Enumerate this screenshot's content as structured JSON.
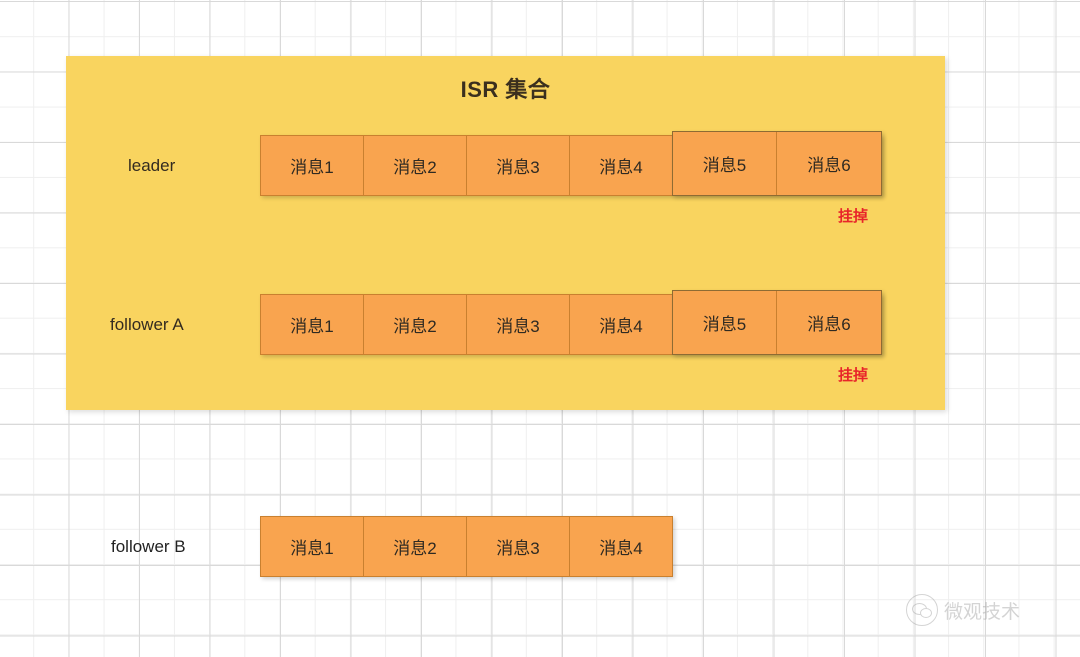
{
  "diagram": {
    "title": "ISR 集合",
    "panel_color": "#f9d45f",
    "message_box_color": "#f9a44f",
    "crash_label_color": "#e8252a",
    "rows": [
      {
        "label": "leader",
        "inside_isr": true,
        "messages": [
          "消息1",
          "消息2",
          "消息3",
          "消息4",
          "消息5",
          "消息6"
        ],
        "grouped_from_index": 4,
        "crash_label": "挂掉"
      },
      {
        "label": "follower A",
        "inside_isr": true,
        "messages": [
          "消息1",
          "消息2",
          "消息3",
          "消息4",
          "消息5",
          "消息6"
        ],
        "grouped_from_index": 4,
        "crash_label": "挂掉"
      },
      {
        "label": "follower B",
        "inside_isr": false,
        "messages": [
          "消息1",
          "消息2",
          "消息3",
          "消息4"
        ],
        "grouped_from_index": null,
        "crash_label": null
      }
    ]
  },
  "watermark": {
    "icon": "wechat-icon",
    "text": "微观技术"
  }
}
